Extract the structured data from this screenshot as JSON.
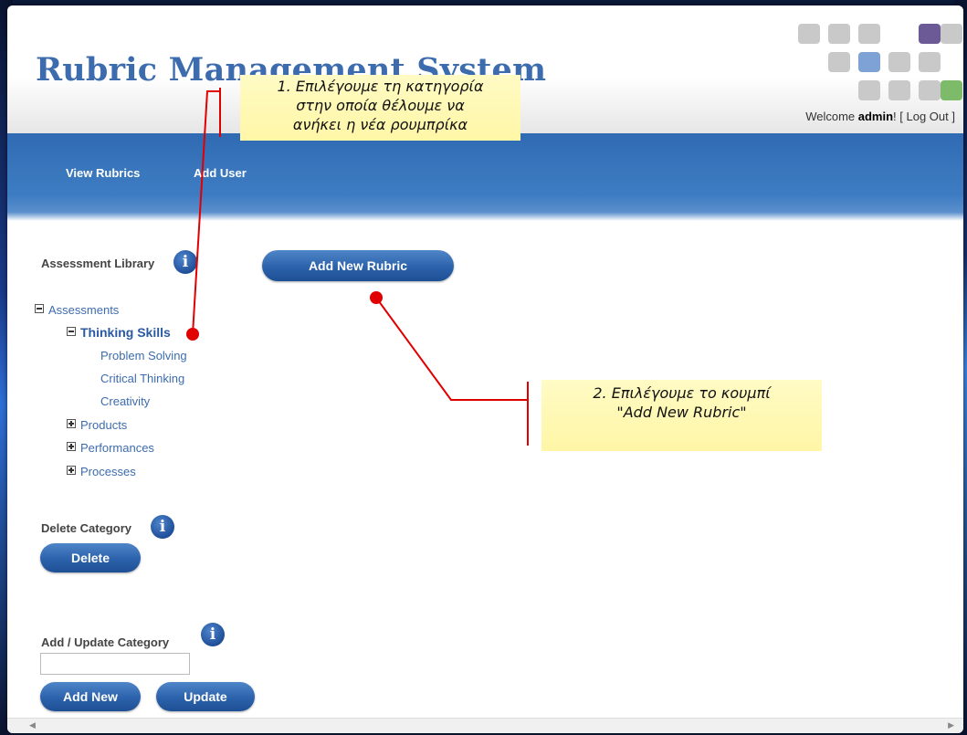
{
  "app": {
    "title": "Rubric Management System",
    "welcome_prefix": "Welcome ",
    "username": "admin",
    "welcome_suffix": "! [ ",
    "logout_label": "Log Out",
    "logout_close": " ]"
  },
  "nav": {
    "items": [
      "View Rubrics",
      "Add User"
    ]
  },
  "logo": {
    "icon": "tile-grid-logo",
    "accent_colors": [
      "#6b5a96",
      "#7ea1d6",
      "#7dbb6a"
    ]
  },
  "library": {
    "label": "Assessment Library",
    "tree": {
      "root": "Assessments",
      "selected": "Thinking Skills",
      "children": [
        "Problem Solving",
        "Critical Thinking",
        "Creativity"
      ],
      "collapsed": [
        "Products",
        "Performances",
        "Processes"
      ]
    }
  },
  "main": {
    "add_rubric_label": "Add New Rubric"
  },
  "delete_category": {
    "label": "Delete Category",
    "button": "Delete"
  },
  "update_category": {
    "label": "Add / Update Category",
    "input_value": "",
    "add_button": "Add New",
    "update_button": "Update"
  },
  "info_glyph": "i",
  "annotations": {
    "step1": [
      "1. Επιλέγουμε τη κατηγορία",
      "στην οποία θέλουμε να",
      "ανήκει η νέα ρουμπρίκα"
    ],
    "step2": [
      "2. Επιλέγουμε το κουμπί",
      "\"Add New Rubric\""
    ],
    "line_color": "#e00000"
  },
  "colors": {
    "brand_blue": "#3d6cae",
    "nav_blue": "#3a77bd",
    "button_blue": "#2c62ab",
    "callout_yellow": "#fff6a6"
  }
}
